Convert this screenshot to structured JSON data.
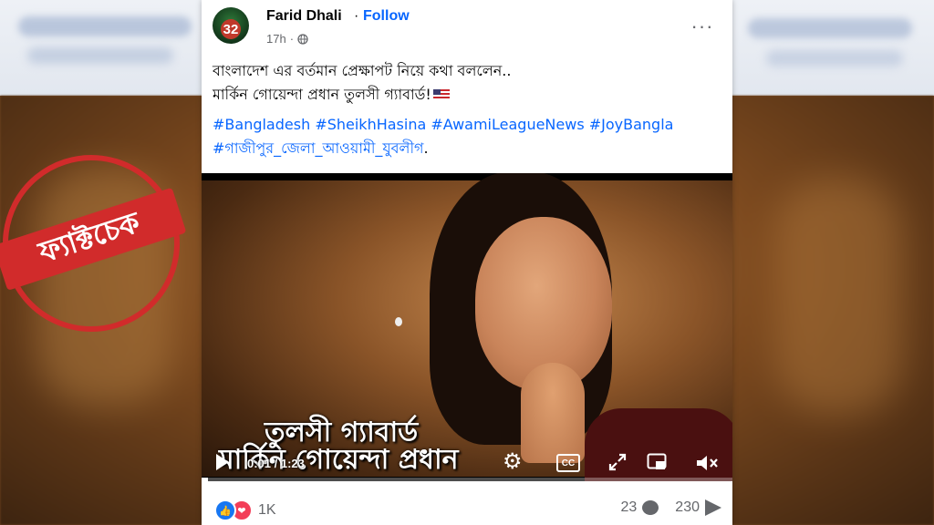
{
  "post": {
    "author": "Farid Dhali",
    "follow_label": "Follow",
    "separator": "·",
    "time": "17h",
    "avatar_text": "32",
    "more_label": "···",
    "text_line1": "বাংলাদেশ এর বর্তমান প্রেক্ষাপট নিয়ে কথা বললেন..",
    "text_line2": "মার্কিন গোয়েন্দা প্রধান তুলসী গ্যাবার্ড!",
    "hashtags": [
      "#Bangladesh",
      "#SheikhHasina",
      "#AwamiLeagueNews",
      "#JoyBangla",
      "#গাজীপুর_জেলা_আওয়ামী_যুবলীগ"
    ],
    "hashtag_trailing": "."
  },
  "video": {
    "stamp_text": "ফ্যাক্টচেক",
    "caption_line1": "তুলসী গ্যাবার্ড",
    "caption_line2": "মার্কিন গোয়েন্দা প্রধান",
    "time_display": "0:01 / 1:23",
    "cc_label": "CC",
    "progress": 0.012
  },
  "footer": {
    "reaction_count": "1K",
    "comment_count": "23",
    "share_count": "230"
  },
  "colors": {
    "accent": "#0866ff",
    "stamp": "#d12b2b",
    "like": "#1877f2",
    "love": "#f33e58"
  },
  "icons": [
    "globe-icon",
    "more-icon",
    "play-icon",
    "settings-icon",
    "captions-icon",
    "expand-icon",
    "pip-icon",
    "mute-icon",
    "like-icon",
    "love-icon",
    "comment-icon",
    "share-icon"
  ]
}
